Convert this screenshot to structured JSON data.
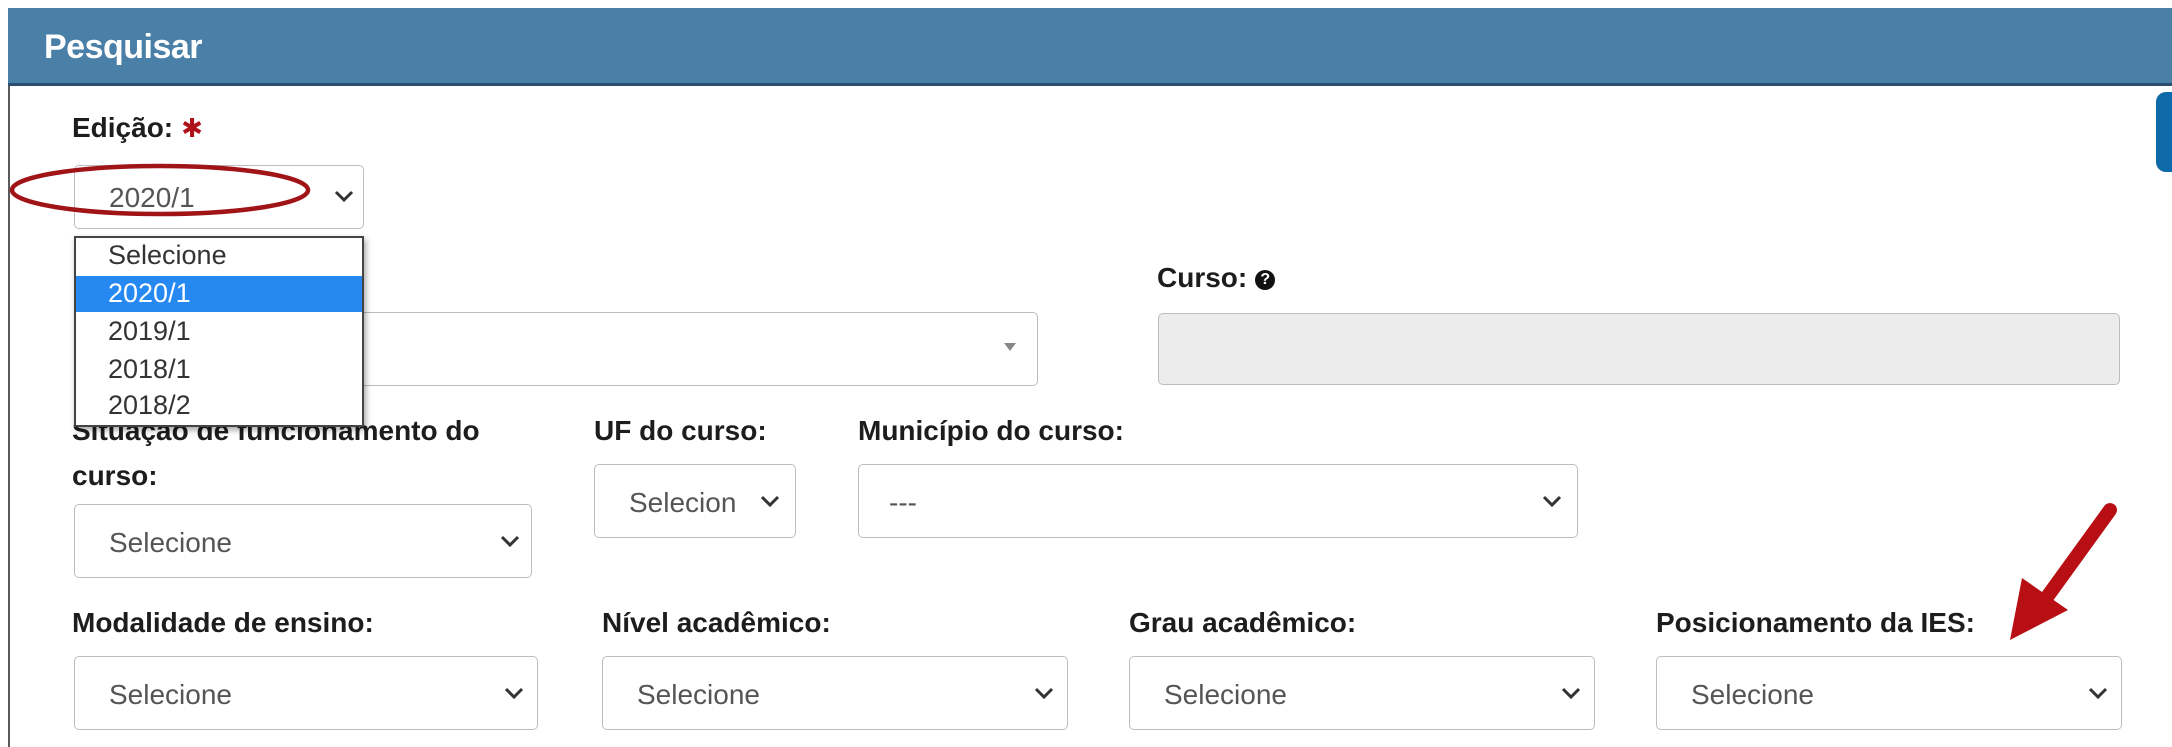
{
  "panel": {
    "title": "Pesquisar"
  },
  "edicao": {
    "label": "Edição:",
    "required_mark": "✱",
    "value": "2020/1",
    "options": [
      "Selecione",
      "2020/1",
      "2019/1",
      "2018/1",
      "2018/2"
    ],
    "selected_index": 1
  },
  "curso": {
    "label": "Curso:",
    "help_icon": "question-circle-icon"
  },
  "situacao": {
    "label_line1": "Situação de funcionamento do",
    "label_line2": "curso:",
    "value": "Selecione"
  },
  "uf": {
    "label": "UF do curso:",
    "value": "Selecion"
  },
  "municipio": {
    "label": "Município do curso:",
    "value": "---"
  },
  "modalidade": {
    "label": "Modalidade de ensino:",
    "value": "Selecione"
  },
  "nivel": {
    "label": "Nível acadêmico:",
    "value": "Selecione"
  },
  "grau": {
    "label": "Grau acadêmico:",
    "value": "Selecione"
  },
  "posicionamento": {
    "label": "Posicionamento da IES:",
    "value": "Selecione"
  },
  "annotations": {
    "ellipse_color": "#a01418",
    "arrow_color": "#b80f14"
  }
}
